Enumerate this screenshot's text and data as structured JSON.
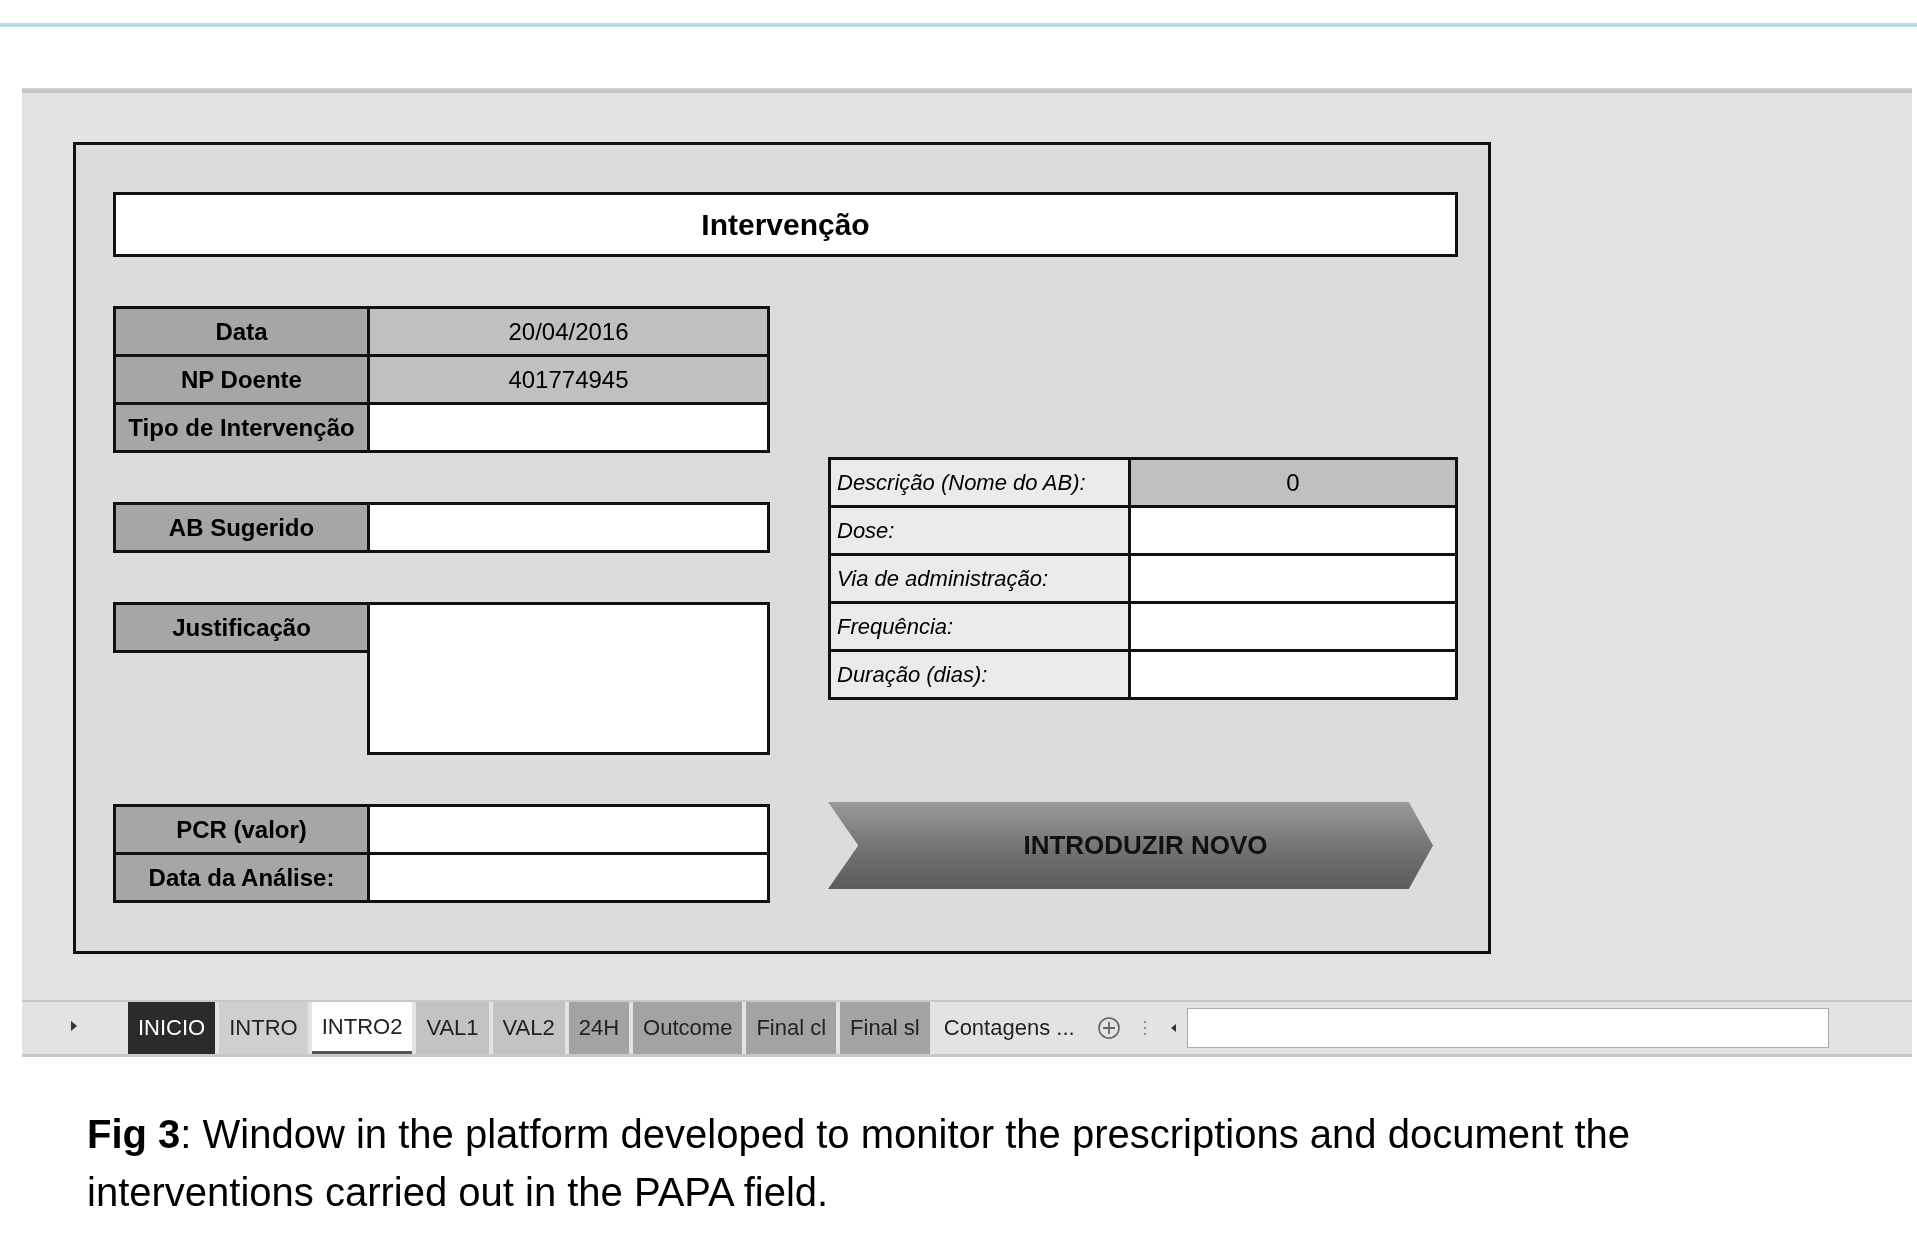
{
  "form": {
    "title": "Intervenção",
    "left_groups": [
      {
        "fields": [
          {
            "label": "Data",
            "value": "20/04/2016",
            "locked": true,
            "kind": "single"
          },
          {
            "label": "NP Doente",
            "value": "401774945",
            "locked": true,
            "kind": "single"
          },
          {
            "label": "Tipo de Intervenção",
            "locked": false,
            "kind": "single"
          }
        ]
      },
      {
        "fields": [
          {
            "label": "AB Sugerido",
            "locked": false,
            "kind": "single"
          }
        ]
      },
      {
        "fields": [
          {
            "label": "Justificação",
            "locked": false,
            "kind": "multiline"
          }
        ]
      },
      {
        "fields": [
          {
            "label": "PCR (valor)",
            "locked": false,
            "kind": "single"
          },
          {
            "label": "Data da Análise:",
            "locked": false,
            "kind": "single"
          }
        ]
      }
    ],
    "right_fields": [
      {
        "label": "Descrição (Nome do AB):",
        "value": "0",
        "locked": true
      },
      {
        "label": "Dose:",
        "locked": false
      },
      {
        "label": "Via de administração:",
        "locked": false
      },
      {
        "label": "Frequência:",
        "locked": false
      },
      {
        "label": "Duração (dias):",
        "locked": false
      }
    ],
    "button": "INTRODUZIR NOVO"
  },
  "sheet_tabs": [
    {
      "label": "INICIO",
      "selected": false,
      "color": "#2b2b2b"
    },
    {
      "label": "INTRO",
      "selected": false,
      "color": "#cfcfcf"
    },
    {
      "label": "INTRO2",
      "selected": true,
      "color": "#ffffff"
    },
    {
      "label": "VAL1",
      "selected": false,
      "color": "#c3c3c3"
    },
    {
      "label": "VAL2",
      "selected": false,
      "color": "#c3c3c3"
    },
    {
      "label": "24H",
      "selected": false,
      "color": "#a3a3a3"
    },
    {
      "label": "Outcome",
      "selected": false,
      "color": "#a3a3a3"
    },
    {
      "label": "Final cl",
      "selected": false,
      "color": "#a3a3a3"
    },
    {
      "label": "Final sl",
      "selected": false,
      "color": "#a3a3a3"
    },
    {
      "label": "Contagens ...",
      "selected": false,
      "color": "#e3e3e3"
    }
  ],
  "caption": "**Fig 3**: Window in the platform developed to monitor the prescriptions and document the interventions carried out in the PAPA field."
}
